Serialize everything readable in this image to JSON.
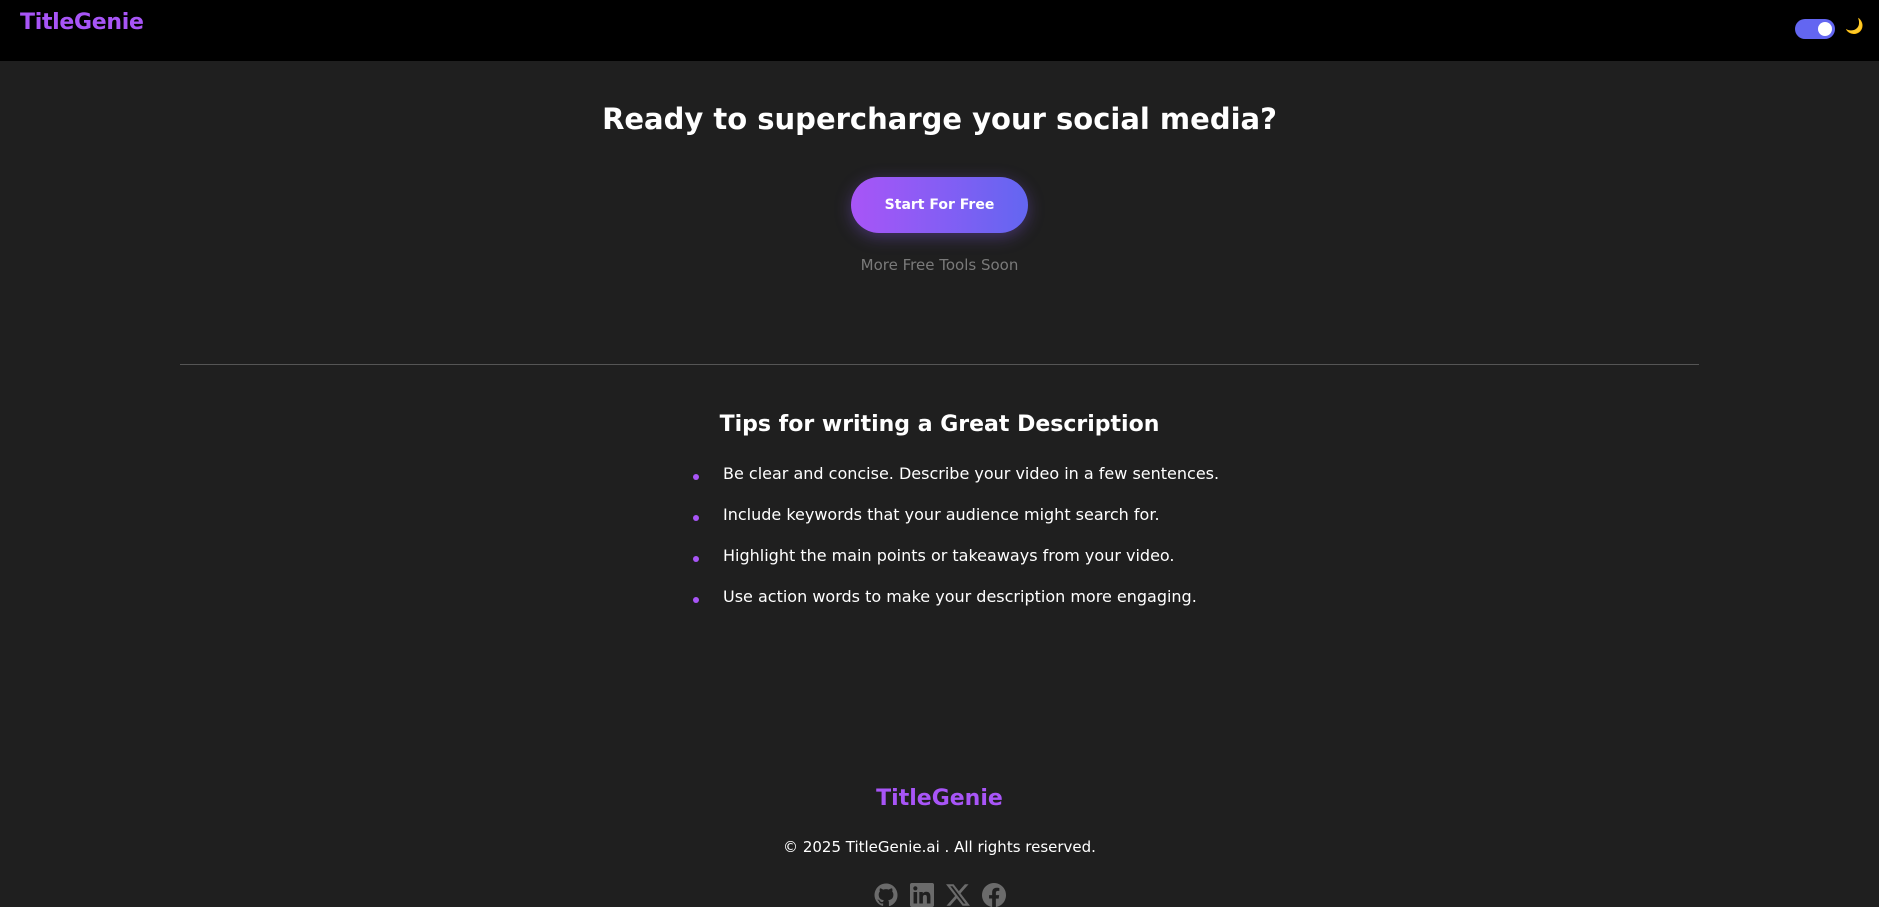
{
  "header": {
    "brand": "TitleGenie",
    "theme_toggle": {
      "state": "on",
      "icon": "moon-icon",
      "glyph": "🌙"
    }
  },
  "cta": {
    "heading": "Ready to supercharge your social media?",
    "button_label": "Start For Free",
    "subtext": "More Free Tools Soon"
  },
  "tips": {
    "heading": "Tips for writing a Great Description",
    "items": [
      "Be clear and concise. Describe your video in a few sentences.",
      "Include keywords that your audience might search for.",
      "Highlight the main points or takeaways from your video.",
      "Use action words to make your description more engaging."
    ]
  },
  "footer": {
    "brand": "TitleGenie",
    "copyright": "© 2025 TitleGenie.ai . All rights reserved.",
    "socials": [
      "github-icon",
      "linkedin-icon",
      "x-icon",
      "facebook-icon"
    ]
  },
  "colors": {
    "header_bg": "#000000",
    "page_bg": "#1f1f1f",
    "accent_purple": "#a855f7",
    "accent_indigo": "#6366f1",
    "muted_text": "#7a7a7a",
    "social_icon": "#6b6b6b"
  }
}
